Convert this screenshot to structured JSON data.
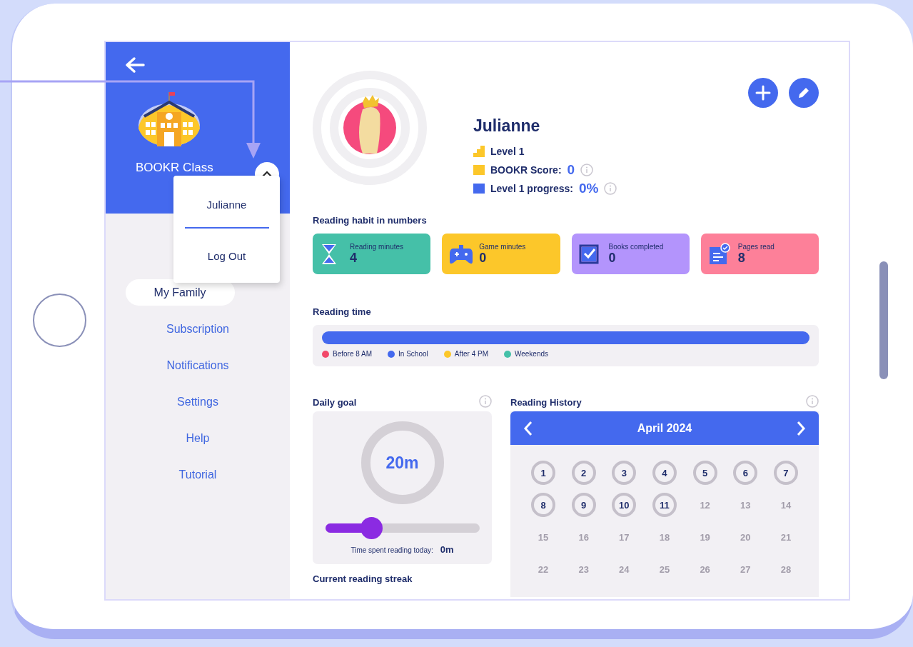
{
  "sidebar": {
    "class_name": "BOOKR Class",
    "menu_open": true,
    "items": [
      {
        "label": "My Family",
        "selected": true
      },
      {
        "label": "Subscription",
        "selected": false
      },
      {
        "label": "Notifications",
        "selected": false
      },
      {
        "label": "Settings",
        "selected": false
      },
      {
        "label": "Help",
        "selected": false
      },
      {
        "label": "Tutorial",
        "selected": false
      }
    ]
  },
  "dropdown": {
    "items": [
      "Julianne",
      "Log Out"
    ]
  },
  "profile": {
    "name": "Julianne",
    "level": "Level 1",
    "score_label": "BOOKR Score:",
    "score": "0",
    "progress_label": "Level 1 progress:",
    "progress": "0%"
  },
  "habit": {
    "title": "Reading habit in numbers",
    "cards": [
      {
        "kind": "hourglass",
        "label": "Reading minutes",
        "value": "4",
        "color": "#45c0a8"
      },
      {
        "kind": "gamepad",
        "label": "Game minutes",
        "value": "0",
        "color": "#fcc72a"
      },
      {
        "kind": "book",
        "label": "Books completed",
        "value": "0",
        "color": "#b394fc"
      },
      {
        "kind": "pages",
        "label": "Pages read",
        "value": "8",
        "color": "#fd8099"
      }
    ]
  },
  "reading_time": {
    "title": "Reading time",
    "legend": [
      {
        "label": "Before 8 AM",
        "color": "#f2496a"
      },
      {
        "label": "In School",
        "color": "#4469ee"
      },
      {
        "label": "After 4 PM",
        "color": "#fcc72a"
      },
      {
        "label": "Weekends",
        "color": "#45c0a8"
      }
    ]
  },
  "daily_goal": {
    "title": "Daily goal",
    "goal": "20m",
    "slider": {
      "level": 0.3
    },
    "today_label": "Time spent reading today:",
    "today": "0m"
  },
  "streak": {
    "title": "Current reading streak"
  },
  "history": {
    "title": "Reading History",
    "month": "April 2024",
    "days": [
      {
        "label": "1",
        "read": true
      },
      {
        "label": "2",
        "read": true
      },
      {
        "label": "3",
        "read": true
      },
      {
        "label": "4",
        "read": true
      },
      {
        "label": "5",
        "read": true
      },
      {
        "label": "6",
        "read": true
      },
      {
        "label": "7",
        "read": true
      },
      {
        "label": "8",
        "read": true
      },
      {
        "label": "9",
        "read": true
      },
      {
        "label": "10",
        "read": true
      },
      {
        "label": "11",
        "read": true
      },
      {
        "label": "12",
        "read": false
      },
      {
        "label": "13",
        "read": false
      },
      {
        "label": "14",
        "read": false
      },
      {
        "label": "15",
        "read": false
      },
      {
        "label": "16",
        "read": false
      },
      {
        "label": "17",
        "read": false
      },
      {
        "label": "18",
        "read": false
      },
      {
        "label": "19",
        "read": false
      },
      {
        "label": "20",
        "read": false
      },
      {
        "label": "21",
        "read": false
      },
      {
        "label": "22",
        "read": false
      },
      {
        "label": "23",
        "read": false
      },
      {
        "label": "24",
        "read": false
      },
      {
        "label": "25",
        "read": false
      },
      {
        "label": "26",
        "read": false
      },
      {
        "label": "27",
        "read": false
      },
      {
        "label": "28",
        "read": false
      }
    ]
  }
}
